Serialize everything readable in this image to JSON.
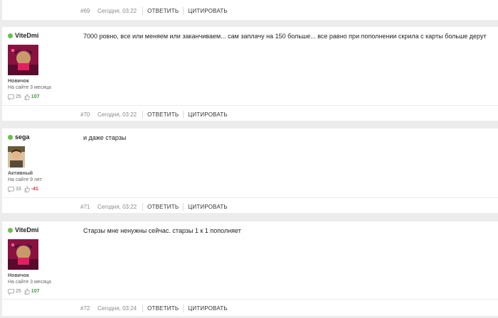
{
  "actions": {
    "reply": "ОТВЕТИТЬ",
    "quote": "ЦИТИРОВАТЬ"
  },
  "colors": {
    "online": "#6abf4b",
    "rep_positive": "#3a9a3a",
    "rep_negative": "#dd3333"
  },
  "icons": {
    "messages": "speech-bubble-icon",
    "likes": "thumbs-up-icon"
  },
  "posts": [
    {
      "number": "#69",
      "date": "Сегодня, 03:22"
    },
    {
      "number": "#70",
      "date": "Сегодня, 03:22",
      "author": {
        "name": "ViteDmi",
        "rank": "Новичок",
        "since": "На сайте 3 месяца",
        "messages": "25",
        "reputation": "107"
      },
      "text": "7000 ровно, все   или меняем или заканчиваем... сам заплачу на 150 больше...   все равно при пополнении скрила с карты больше дерут"
    },
    {
      "number": "#71",
      "date": "Сегодня, 03:22",
      "author": {
        "name": "sega",
        "rank": "Активный",
        "since": "На сайте 9 лет",
        "messages": "33",
        "reputation": "-41"
      },
      "text": "и даже старзы"
    },
    {
      "number": "#72",
      "date": "Сегодня, 03:24",
      "author": {
        "name": "ViteDmi",
        "rank": "Новичок",
        "since": "На сайте 3 месяца",
        "messages": "25",
        "reputation": "107"
      },
      "text": "Старзы мне ненужны сейчас.  старзы 1 к 1 пополняет"
    }
  ]
}
